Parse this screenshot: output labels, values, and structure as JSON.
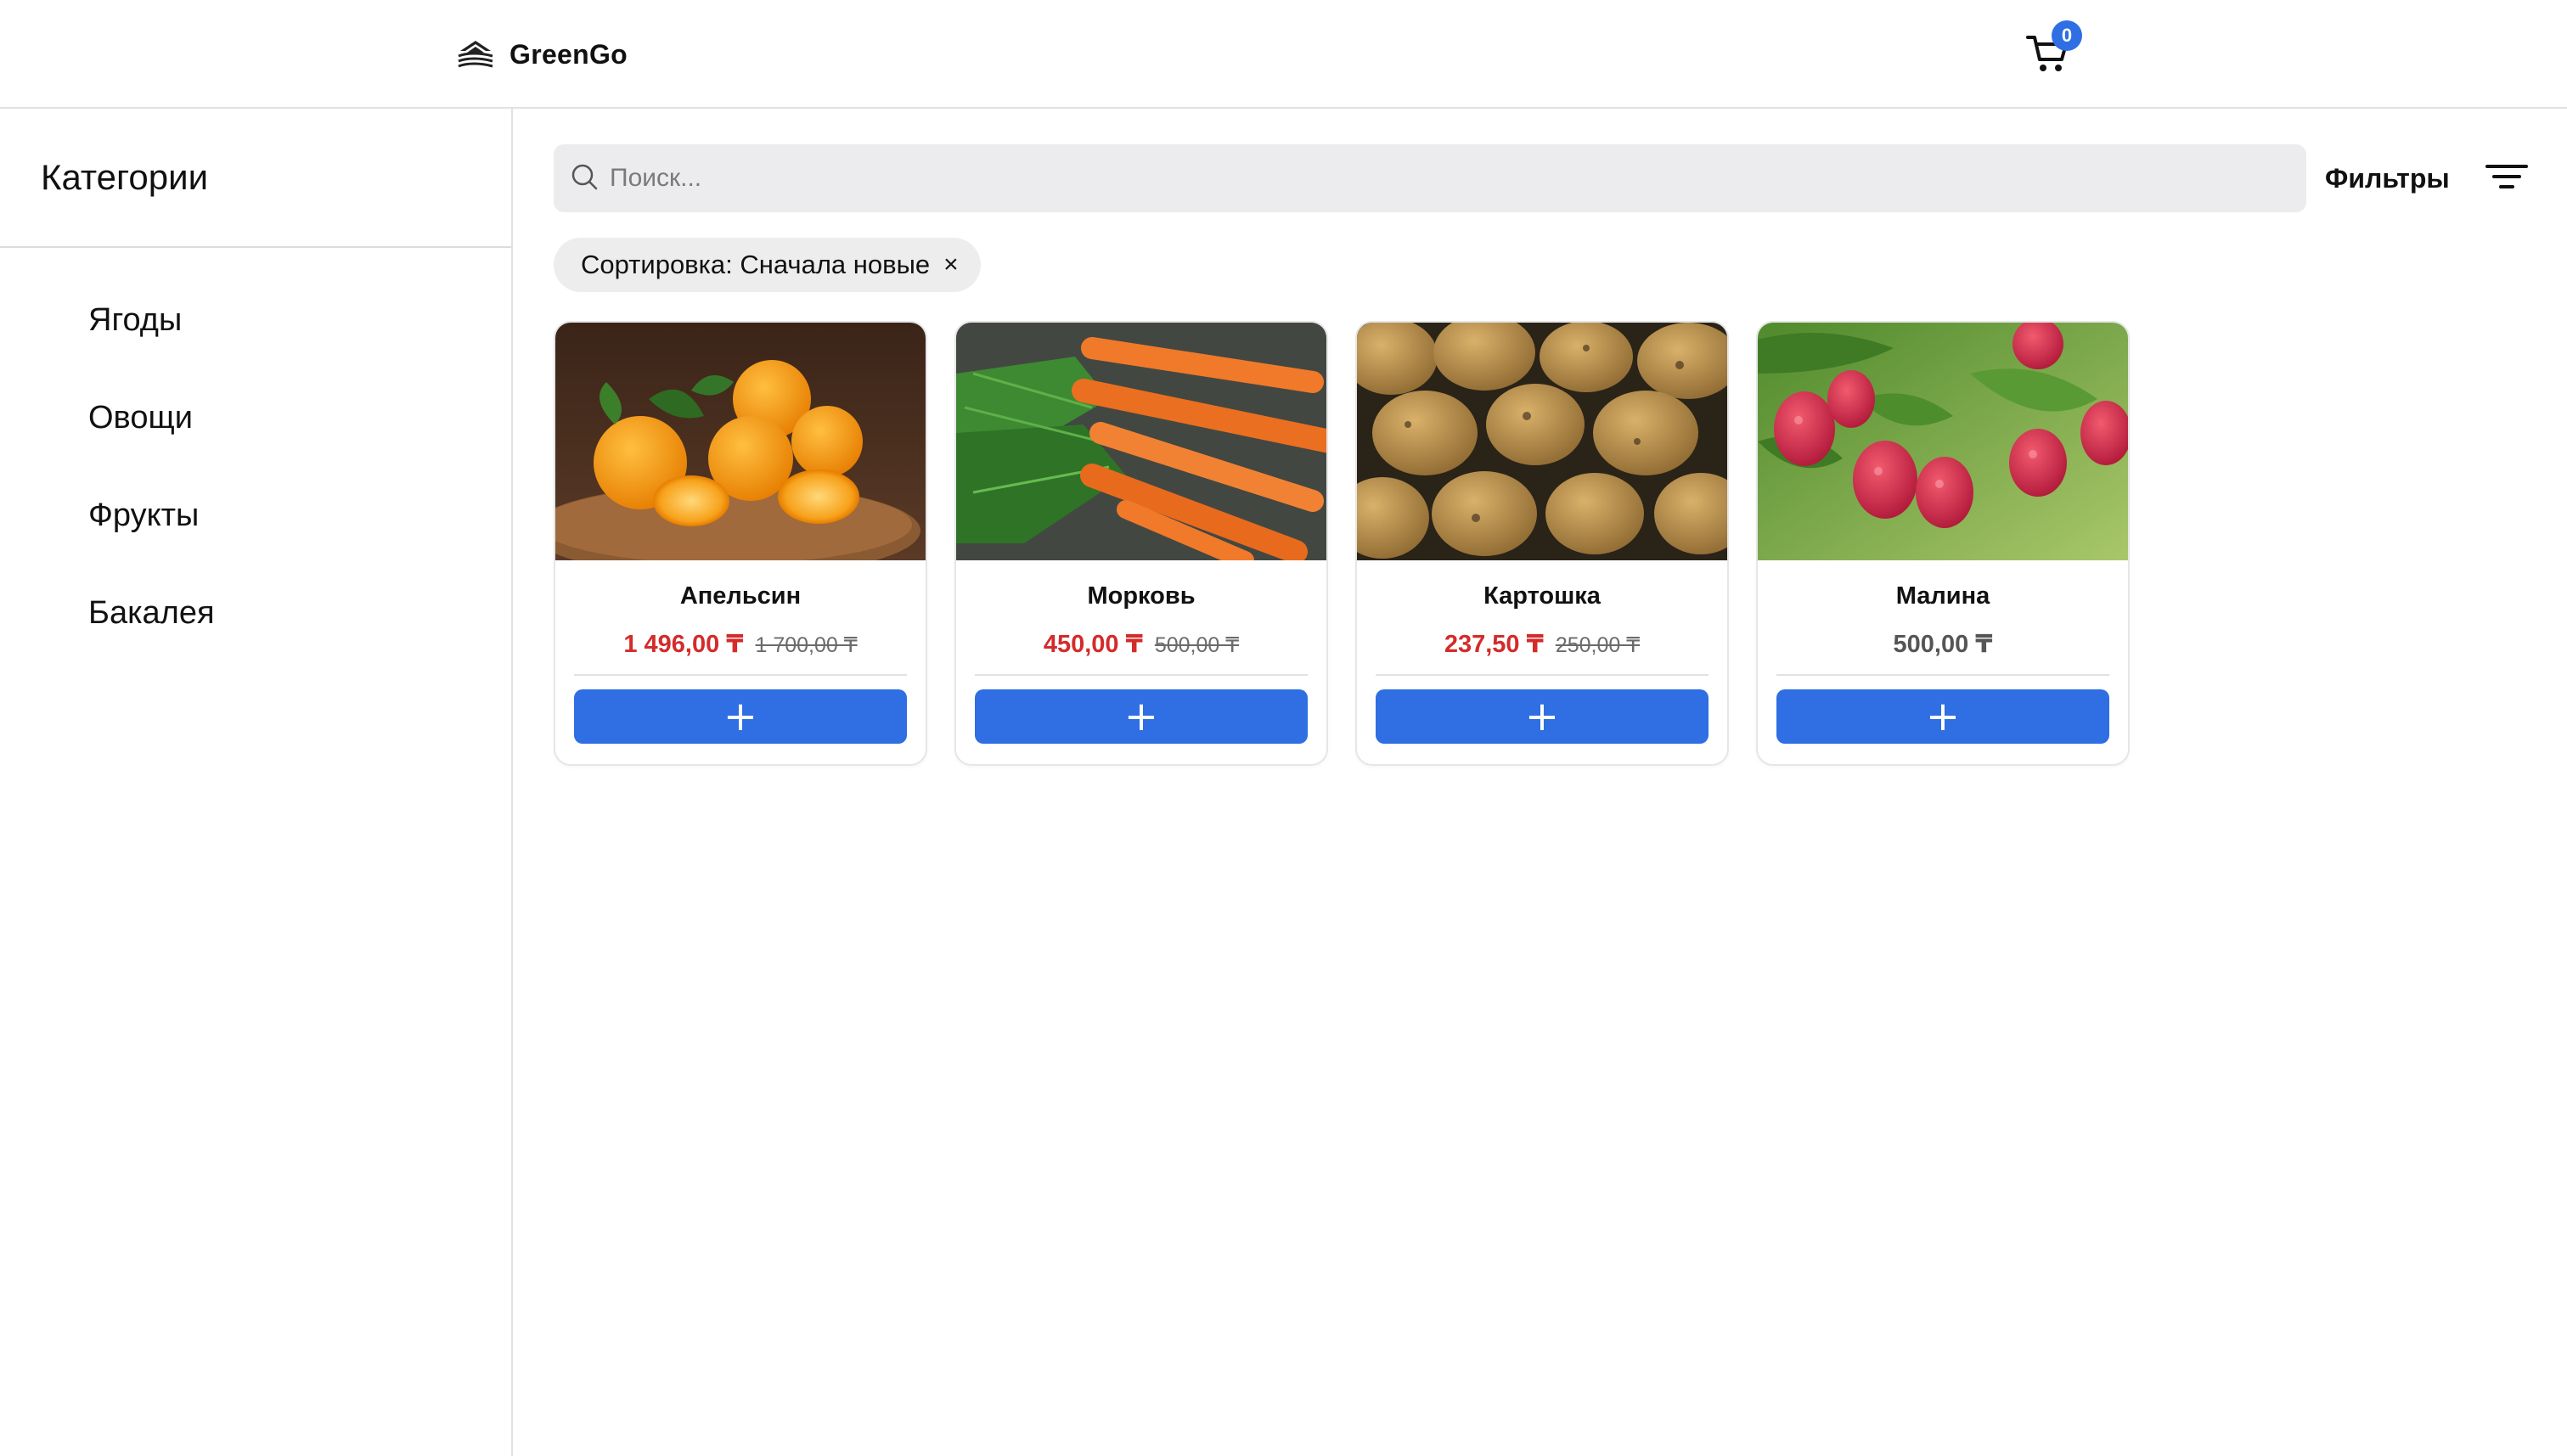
{
  "header": {
    "brand": "GreenGo",
    "cart_count": "0"
  },
  "sidebar": {
    "title": "Категории",
    "items": [
      {
        "label": "Ягоды"
      },
      {
        "label": "Овощи"
      },
      {
        "label": "Фрукты"
      },
      {
        "label": "Бакалея"
      }
    ]
  },
  "search": {
    "placeholder": "Поиск..."
  },
  "filters": {
    "label": "Фильтры"
  },
  "sort_chip": {
    "label": "Сортировка: Сначала новые",
    "close": "×"
  },
  "products": [
    {
      "name": "Апельсин",
      "price": "1 496,00 ₸",
      "old_price": "1 700,00 ₸",
      "image": "oranges"
    },
    {
      "name": "Морковь",
      "price": "450,00 ₸",
      "old_price": "500,00 ₸",
      "image": "carrots"
    },
    {
      "name": "Картошка",
      "price": "237,50 ₸",
      "old_price": "250,00 ₸",
      "image": "potatoes"
    },
    {
      "name": "Малина",
      "price": "500,00 ₸",
      "old_price": "",
      "image": "raspberries"
    }
  ],
  "add_button_label": "+",
  "colors": {
    "accent": "#2f6ee3",
    "sale_price": "#d42b2b",
    "search_bg": "#ececee"
  }
}
